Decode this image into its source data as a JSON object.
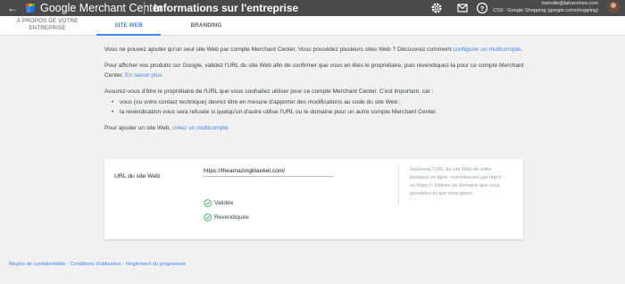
{
  "header": {
    "back_icon": "arrow-left-icon",
    "brand": "Google Merchant Center",
    "title": "Informations sur l'entreprise",
    "icons": [
      "gear-icon",
      "mail-icon",
      "help-icon"
    ],
    "account_email": "melodie@latranchee.com",
    "account_name": "CSS : Google Shopping (google.com/shopping)"
  },
  "tabs": [
    {
      "label": "À PROPOS DE VOTRE ENTREPRISE",
      "active": false
    },
    {
      "label": "SITE WEB",
      "active": true
    },
    {
      "label": "BRANDING",
      "active": false
    }
  ],
  "intro": {
    "p1_text": "Vous ne pouvez ajouter qu'un seul site Web par compte Merchant Center. Vous possédez plusieurs sites Web ? Découvrez comment ",
    "p1_link": "configurer un multicompte",
    "p1_end": ".",
    "p2_text": "Pour afficher vos produits sur Google, validez l'URL du site Web afin de confirmer que vous en êtes le propriétaire, puis revendiquez-la pour ce compte Merchant Center. ",
    "p2_link": "En savoir plus",
    "p3_text": "Assurez-vous d'être le propriétaire de l'URL que vous souhaitez utiliser pour ce compte Merchant Center. C'est important, car :",
    "bullets": [
      "vous (ou votre contact technique) devrez être en mesure d'apporter des modifications au code du site Web ;",
      "la revendication vous sera refusée si quelqu'un d'autre utilise l'URL ou le domaine pour un autre compte Merchant Center."
    ],
    "p4_text": "Pour ajouter un site Web, ",
    "p4_link": "créez un multicompte"
  },
  "website_card": {
    "label": "URL du site Web",
    "url_value": "https://theamazingblanket.com/",
    "status_validated": "Validée",
    "status_claimed": "Revendiquée",
    "help_text": "Saisissez l'URL du site Web de votre boutique en ligne, commençant par http:// ou https://. Utilisez un domaine que vous possédez et que vous gérez.",
    "status_color": "#34a853"
  },
  "footer": {
    "privacy": "Règles de confidentialité",
    "terms": "Conditions d'utilisation",
    "program": "Règlement du programme",
    "separator": "·"
  },
  "colors": {
    "topbar": "#4a4a4a",
    "accent": "#4285f4",
    "background": "#f1f1f1"
  }
}
